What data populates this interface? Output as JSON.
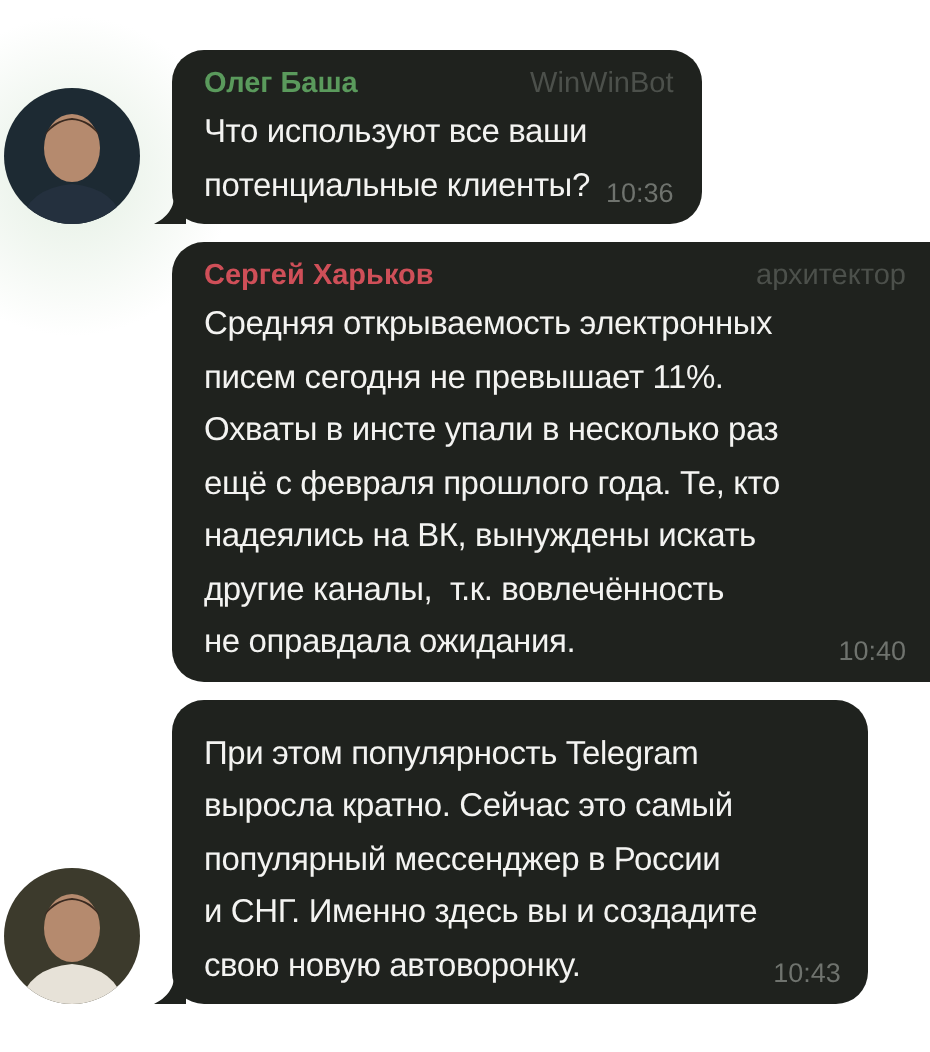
{
  "messages": [
    {
      "sender": "Олег Баша",
      "color": "#5a9a5c",
      "tag": "WinWinBot",
      "text": "Что используют все ваши\nпотенциальные клиенты?",
      "time": "10:36",
      "avatar": true
    },
    {
      "sender": "Сергей Харьков",
      "color": "#cf4f58",
      "tag": "архитектор",
      "text": "Средняя открываемость электронных\nписем сегодня не превышает 11%.\nОхваты в инсте упали в несколько раз\nещё с февраля прошлого года. Те, кто\nнадеялись на ВК, вынуждены искать\nдругие каналы,  т.к. вовлечённость\nне оправдала ожидания.",
      "time": "10:40",
      "avatar": false
    },
    {
      "text": "При этом популярность Telegram\nвыросла кратно. Сейчас это самый\nпопулярный мессенджер в России\nи СНГ. Именно здесь вы и создадите\nсвою новую автоворонку.",
      "time": "10:43",
      "avatar": true
    }
  ]
}
